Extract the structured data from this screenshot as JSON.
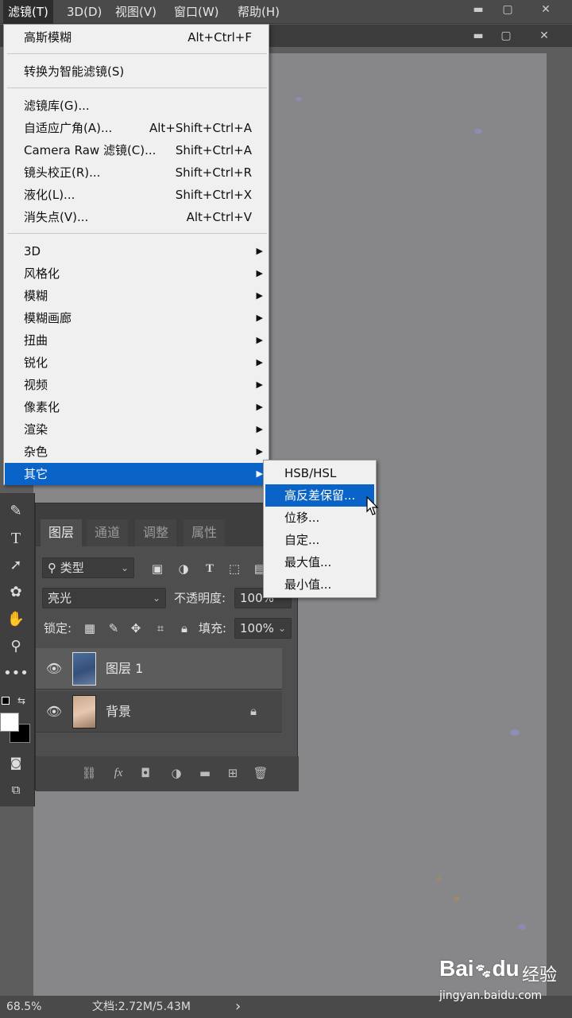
{
  "menubar": {
    "items": [
      "滤镜(T)",
      "3D(D)",
      "视图(V)",
      "窗口(W)",
      "帮助(H)"
    ],
    "window_controls": {
      "minimize": "▬",
      "restore": "▢",
      "close": "✕"
    }
  },
  "filter_menu": {
    "last_filter": {
      "label": "高斯模糊",
      "shortcut": "Alt+Ctrl+F"
    },
    "convert": {
      "label": "转换为智能滤镜(S)"
    },
    "group2": [
      {
        "label": "滤镜库(G)...",
        "shortcut": ""
      },
      {
        "label": "自适应广角(A)...",
        "shortcut": "Alt+Shift+Ctrl+A"
      },
      {
        "label": "Camera Raw 滤镜(C)...",
        "shortcut": "Shift+Ctrl+A"
      },
      {
        "label": "镜头校正(R)...",
        "shortcut": "Shift+Ctrl+R"
      },
      {
        "label": "液化(L)...",
        "shortcut": "Shift+Ctrl+X"
      },
      {
        "label": "消失点(V)...",
        "shortcut": "Alt+Ctrl+V"
      }
    ],
    "submenus": [
      "3D",
      "风格化",
      "模糊",
      "模糊画廊",
      "扭曲",
      "锐化",
      "视频",
      "像素化",
      "渲染",
      "杂色",
      "其它"
    ],
    "highlighted": "其它"
  },
  "other_submenu": {
    "items": [
      "HSB/HSL",
      "高反差保留...",
      "位移...",
      "自定...",
      "最大值...",
      "最小值..."
    ],
    "highlighted": "高反差保留..."
  },
  "layers_panel": {
    "tabs": [
      "图层",
      "通道",
      "调整",
      "属性"
    ],
    "active_tab": "图层",
    "filter_kind": "类型",
    "blend_mode": "亮光",
    "opacity_label": "不透明度:",
    "opacity_value": "100%",
    "lock_label": "锁定:",
    "fill_label": "填充:",
    "fill_value": "100%",
    "layers": [
      {
        "name": "图层 1",
        "selected": true,
        "locked": false
      },
      {
        "name": "背景",
        "selected": false,
        "locked": true
      }
    ]
  },
  "status": {
    "zoom": "68.5%",
    "doc": "文档:2.72M/5.43M",
    "arrow": "›"
  },
  "watermark": {
    "logo": "Bai",
    "paw": "du",
    "cn": "经验",
    "url": "jingyan.baidu.com"
  },
  "colors": {
    "menu_highlight": "#0a64c8",
    "menu_bg": "#f0f0f0",
    "canvas": "#878789",
    "panel": "#4e4e4e"
  }
}
